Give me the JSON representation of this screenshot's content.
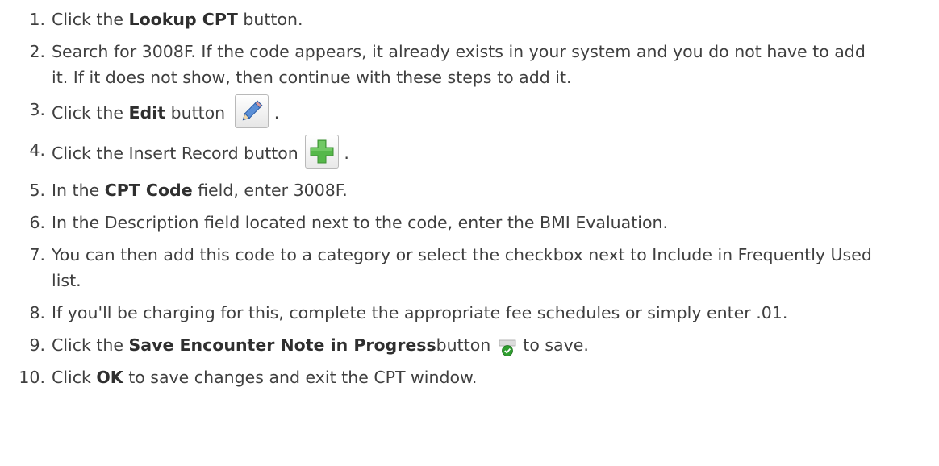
{
  "steps": [
    {
      "num": "1.",
      "a": "Click the ",
      "b": "Lookup CPT",
      "c": " button."
    },
    {
      "num": "2.",
      "text": "Search for 3008F. If the code appears, it already exists in your system and you do not have to add it. If it does not show, then continue with these steps to add it."
    },
    {
      "num": "3.",
      "a": "Click the ",
      "b": "Edit",
      "c": " button",
      "d": ".",
      "icon": "pencil-edit-icon"
    },
    {
      "num": "4.",
      "a": "Click the Insert Record button",
      "d": ".",
      "icon": "green-plus-icon"
    },
    {
      "num": "5.",
      "a": "In the ",
      "b": "CPT Code",
      "c": " field, enter 3008F."
    },
    {
      "num": "6.",
      "text": "In the Description field located next to the code, enter the BMI Evaluation."
    },
    {
      "num": "7.",
      "text": "You can then add this code to a category or select the checkbox next to Include in Frequently Used list."
    },
    {
      "num": "8.",
      "text": "If you'll be charging for this, complete the appropriate fee schedules or simply enter .01."
    },
    {
      "num": "9.",
      "a": "Click the ",
      "b": "Save Encounter Note in Progress",
      "c": "button",
      "d": "to save.",
      "icon": "save-check-icon"
    },
    {
      "num": "10.",
      "a": "Click ",
      "b": "OK",
      "c": " to save changes and exit the CPT window."
    }
  ],
  "colors": {
    "text": "#3f3f3f",
    "plus_green": "#56b84a",
    "check_green": "#2f9e2f"
  }
}
